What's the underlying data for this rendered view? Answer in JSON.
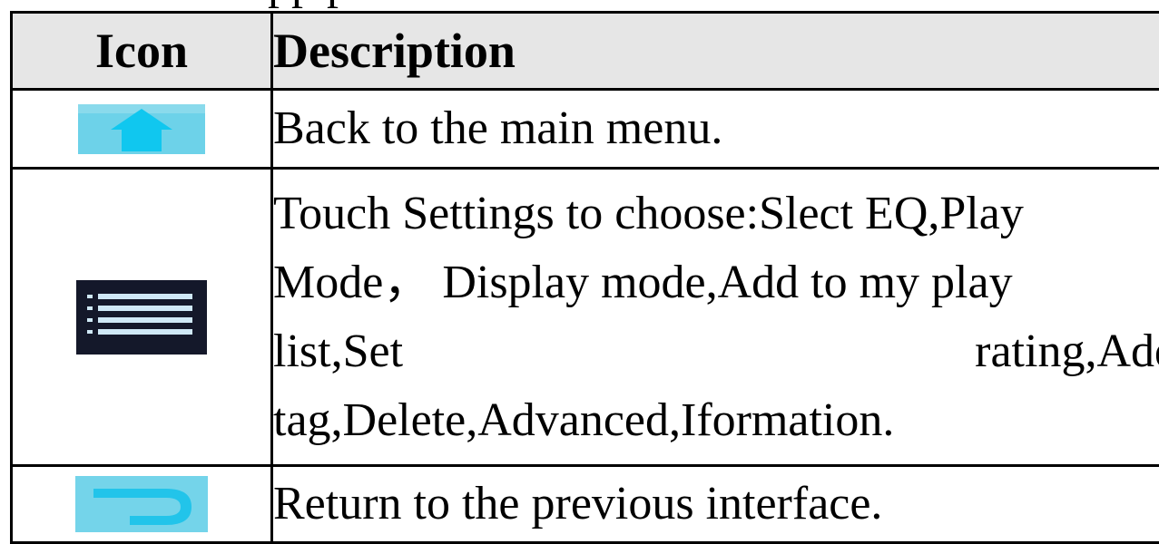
{
  "title_fragment": "pp p",
  "table": {
    "header": {
      "icon": "Icon",
      "description": "Description"
    },
    "rows": [
      {
        "icon_name": "home-icon",
        "description": "Back to the main menu."
      },
      {
        "icon_name": "menu-icon",
        "description_lines": [
          "Touch Settings to choose:Slect EQ,Play",
          "Mode， Display mode,Add to my play",
          "list,Set rating,Add",
          "tag,Delete,Advanced,Iformation."
        ]
      },
      {
        "icon_name": "back-icon",
        "description": "Return to the previous interface."
      }
    ]
  },
  "colors": {
    "icon_cyan": "#3cc6e4",
    "icon_menu_bg": "#14182a",
    "header_bg": "#e6e6e6"
  }
}
